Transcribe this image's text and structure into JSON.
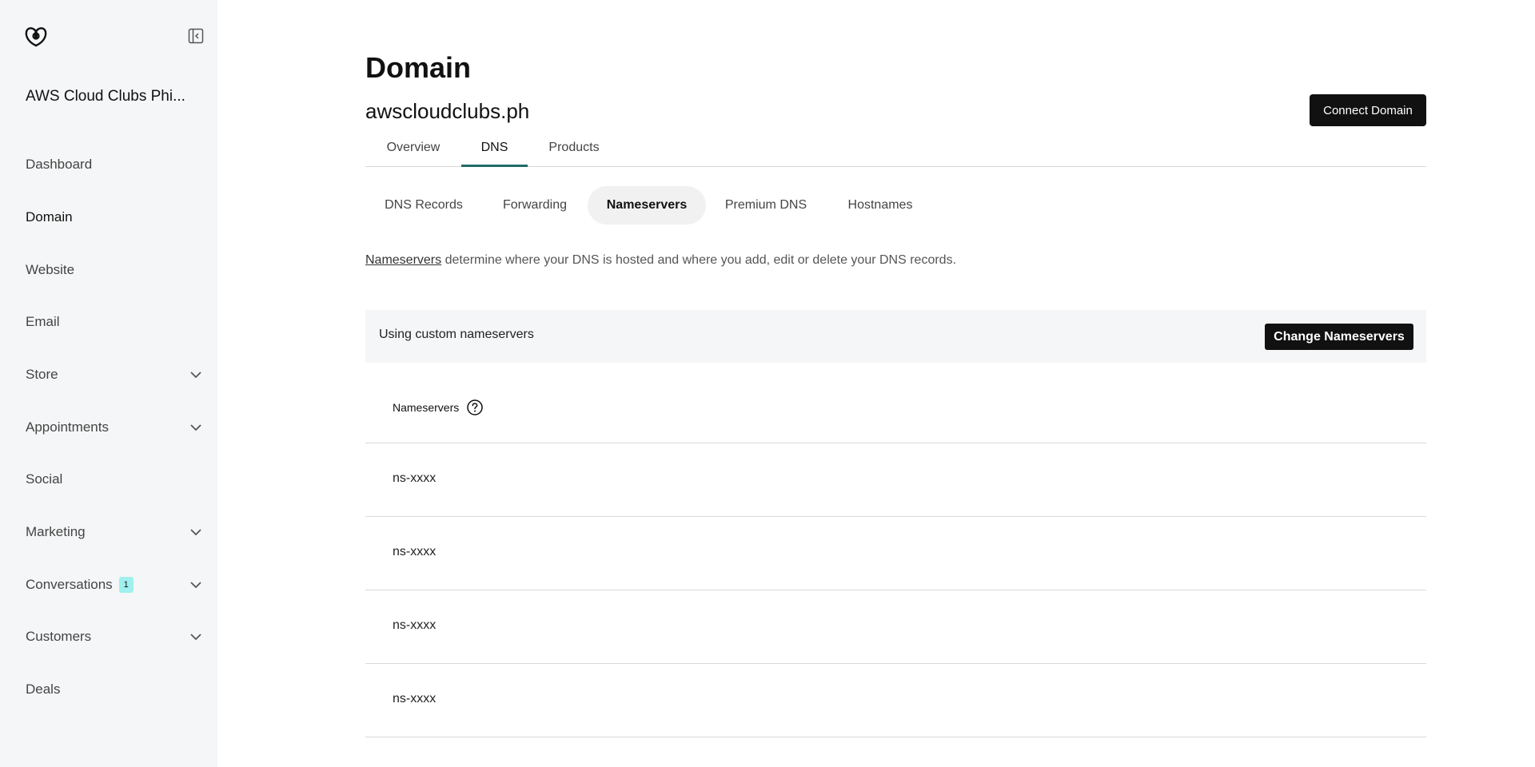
{
  "sidebar": {
    "account_name": "AWS Cloud Clubs Phi...",
    "items": [
      {
        "label": "Dashboard",
        "expandable": false
      },
      {
        "label": "Domain",
        "expandable": false,
        "active": true
      },
      {
        "label": "Website",
        "expandable": false
      },
      {
        "label": "Email",
        "expandable": false
      },
      {
        "label": "Store",
        "expandable": true
      },
      {
        "label": "Appointments",
        "expandable": true
      },
      {
        "label": "Social",
        "expandable": false
      },
      {
        "label": "Marketing",
        "expandable": true
      },
      {
        "label": "Conversations",
        "expandable": true,
        "badge": "1"
      },
      {
        "label": "Customers",
        "expandable": true
      },
      {
        "label": "Deals",
        "expandable": false
      }
    ]
  },
  "header": {
    "title": "Domain",
    "domain": "awscloudclubs.ph",
    "connect_label": "Connect Domain"
  },
  "tabs": [
    {
      "label": "Overview"
    },
    {
      "label": "DNS",
      "active": true
    },
    {
      "label": "Products"
    }
  ],
  "subtabs": [
    {
      "label": "DNS Records"
    },
    {
      "label": "Forwarding"
    },
    {
      "label": "Nameservers",
      "active": true
    },
    {
      "label": "Premium DNS"
    },
    {
      "label": "Hostnames"
    }
  ],
  "description": {
    "link": "Nameservers",
    "text": " determine where your DNS is hosted and where you add, edit or delete your DNS records."
  },
  "status": {
    "text": "Using custom nameservers",
    "button_label": "Change Nameservers"
  },
  "nameservers": {
    "header": "Nameservers",
    "rows": [
      "ns-xxxx",
      "ns-xxxx",
      "ns-xxxx",
      "ns-xxxx"
    ]
  },
  "colors": {
    "accent": "#1f6b68",
    "badge": "#9ff0ee",
    "dark_button": "#111111",
    "sidebar_bg": "#f5f6f7"
  }
}
